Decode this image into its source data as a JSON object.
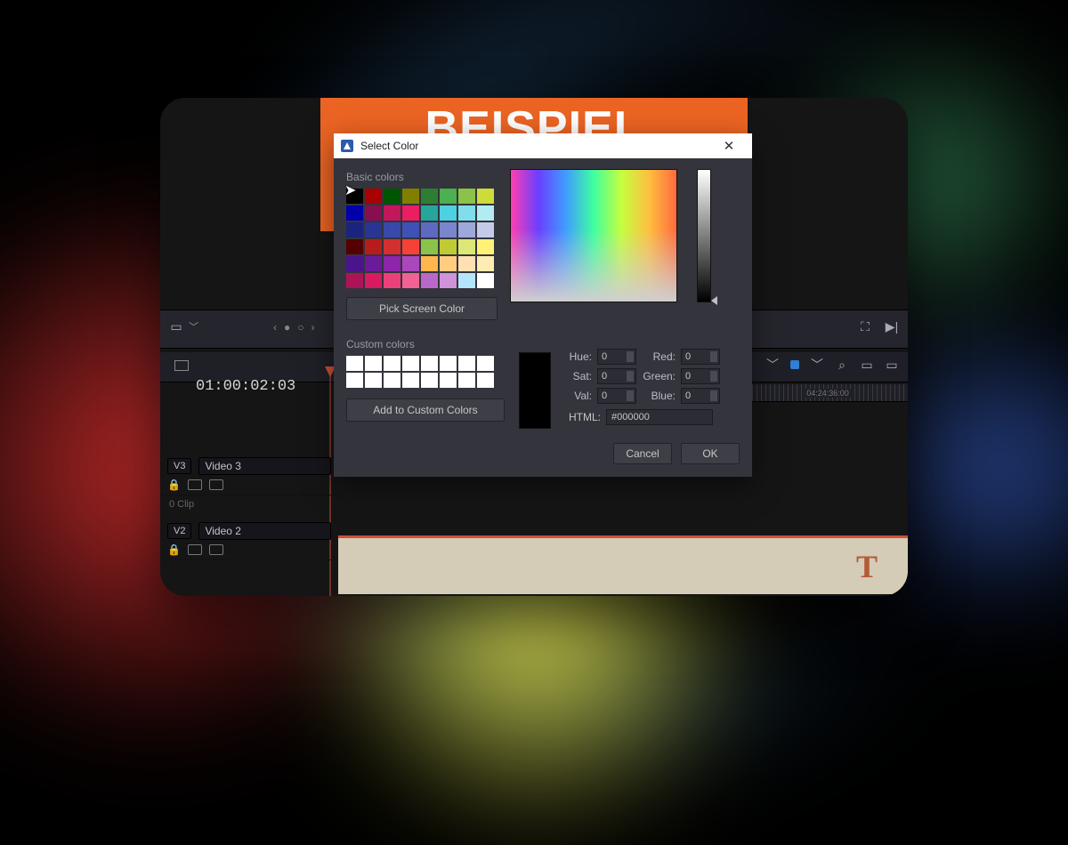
{
  "preview": {
    "text": "BEISPIEL"
  },
  "timecode": "01:00:02:03",
  "ruler_mark": "04:24:36:00",
  "tracks": [
    {
      "tag": "V3",
      "name": "Video 3",
      "subtitle": "0 Clip"
    },
    {
      "tag": "V2",
      "name": "Video 2",
      "subtitle": ""
    }
  ],
  "dialog": {
    "title": "Select Color",
    "basic_label": "Basic colors",
    "custom_label": "Custom colors",
    "pick_btn": "Pick Screen Color",
    "add_btn": "Add to Custom Colors",
    "labels": {
      "hue": "Hue:",
      "sat": "Sat:",
      "val": "Val:",
      "red": "Red:",
      "green": "Green:",
      "blue": "Blue:",
      "html": "HTML:"
    },
    "vals": {
      "hue": "0",
      "sat": "0",
      "val": "0",
      "red": "0",
      "green": "0",
      "blue": "0",
      "html": "#000000"
    },
    "cancel": "Cancel",
    "ok": "OK",
    "basic_colors": [
      "#000000",
      "#aa0000",
      "#005500",
      "#808000",
      "#2e7d32",
      "#4caf50",
      "#8bc34a",
      "#cddc39",
      "#0000aa",
      "#880e4f",
      "#c2185b",
      "#e91e63",
      "#26a69a",
      "#4dd0e1",
      "#80deea",
      "#b2ebf2",
      "#1a237e",
      "#283593",
      "#3949ab",
      "#3f51b5",
      "#5c6bc0",
      "#7986cb",
      "#9fa8da",
      "#c5cae9",
      "#550000",
      "#b71c1c",
      "#d32f2f",
      "#f44336",
      "#8bc34a",
      "#c0ca33",
      "#dce775",
      "#fff176",
      "#4a148c",
      "#6a1b9a",
      "#8e24aa",
      "#ab47bc",
      "#ffb74d",
      "#ffcc80",
      "#ffe0b2",
      "#ffecb3",
      "#ad1457",
      "#d81b60",
      "#ec407a",
      "#f06292",
      "#ba68c8",
      "#ce93d8",
      "#b3e5fc",
      "#ffffff"
    ]
  },
  "clip_glyph": "T"
}
